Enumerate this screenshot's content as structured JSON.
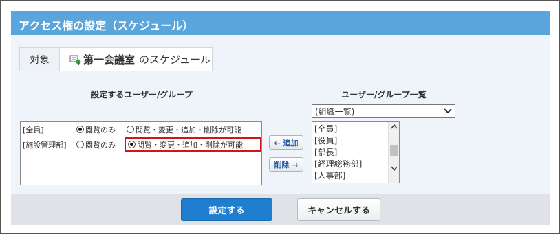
{
  "header": {
    "title": "アクセス権の設定（スケジュール）"
  },
  "target": {
    "label": "対象",
    "icon": "facility-icon",
    "name": "第一会議室",
    "suffix": "のスケジュール"
  },
  "set_section": {
    "title": "設定するユーザー/グループ"
  },
  "list_section": {
    "title": "ユーザー/グループ一覧",
    "select_value": "(組織一覧)",
    "items": [
      "[全員]",
      "[役員]",
      "[部長]",
      "[経理総務部]",
      "[人事部]"
    ]
  },
  "acl_rows": [
    {
      "name": "[全員]",
      "view_label": "閲覧のみ",
      "full_label": "閲覧・変更・追加・削除が可能",
      "selected": "view"
    },
    {
      "name": "[施設管理部]",
      "view_label": "閲覧のみ",
      "full_label": "閲覧・変更・追加・削除が可能",
      "selected": "full"
    }
  ],
  "buttons": {
    "add": "← 追加",
    "remove": "削除 →",
    "submit": "設定する",
    "cancel": "キャンセルする"
  },
  "colors": {
    "header_bg": "#5aa5db",
    "panel_bg": "#eef4fa",
    "highlight_border": "#d0161b",
    "primary_button": "#1f7ecf"
  }
}
